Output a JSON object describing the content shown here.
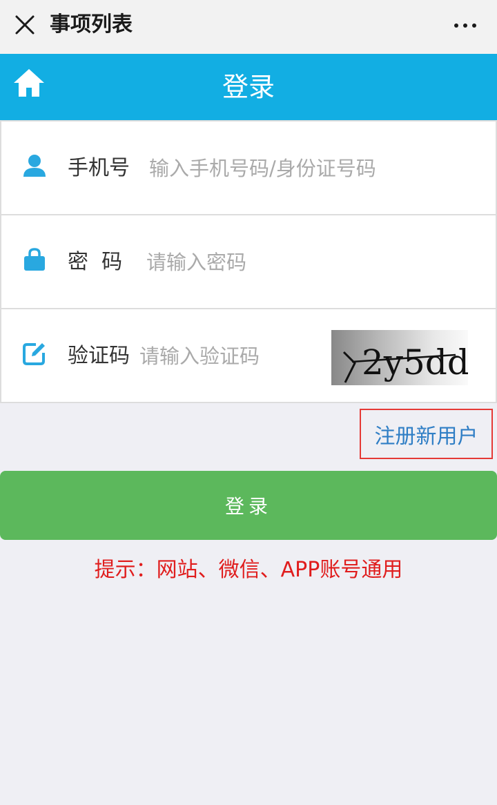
{
  "topbar": {
    "title": "事项列表",
    "close_icon": "close-icon",
    "more_icon": "more-icon"
  },
  "header": {
    "title": "登录",
    "home_icon": "home-icon",
    "bg_color": "#12aee3"
  },
  "form": {
    "phone": {
      "label": "手机号",
      "placeholder": "输入手机号码/身份证号码",
      "value": "",
      "icon": "user-icon"
    },
    "password": {
      "label": "密  码",
      "placeholder": "请输入密码",
      "value": "",
      "icon": "lock-icon"
    },
    "captcha": {
      "label": "验证码",
      "placeholder": "请输入验证码",
      "value": "",
      "icon": "edit-icon",
      "image_text": "2y5dd"
    }
  },
  "register_link": "注册新用户",
  "login_button": "登录",
  "hint": "提示：网站、微信、APP账号通用",
  "colors": {
    "accent": "#12aee3",
    "button": "#5cb85c",
    "link": "#2f7ec5",
    "hint": "#e01d1d"
  }
}
